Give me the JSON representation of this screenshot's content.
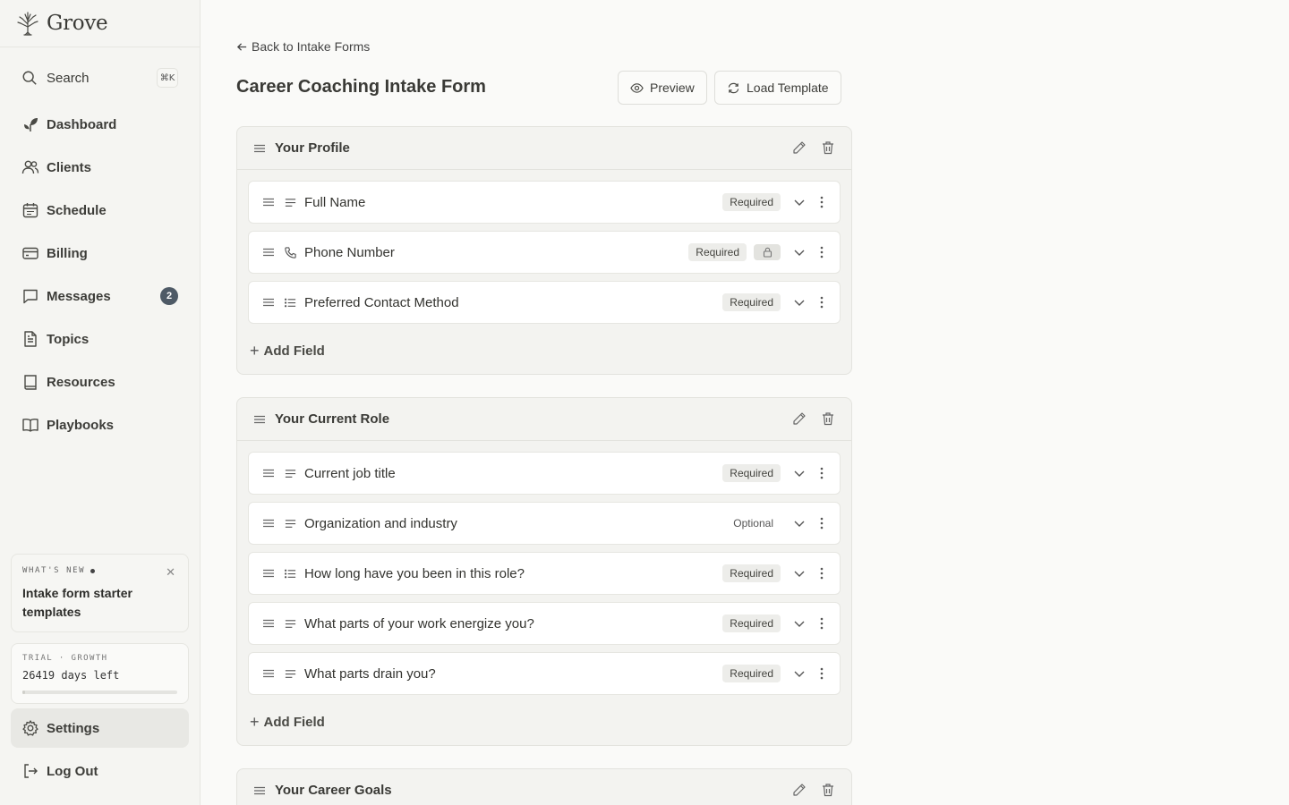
{
  "brand": {
    "name": "Grove"
  },
  "sidebar": {
    "search": {
      "label": "Search",
      "shortcut": "⌘K"
    },
    "items": [
      {
        "key": "dashboard",
        "label": "Dashboard",
        "icon": "sprout-icon"
      },
      {
        "key": "clients",
        "label": "Clients",
        "icon": "users-icon"
      },
      {
        "key": "schedule",
        "label": "Schedule",
        "icon": "calendar-icon"
      },
      {
        "key": "billing",
        "label": "Billing",
        "icon": "credit-card-icon"
      },
      {
        "key": "messages",
        "label": "Messages",
        "icon": "message-icon",
        "badge": "2"
      },
      {
        "key": "topics",
        "label": "Topics",
        "icon": "document-icon"
      },
      {
        "key": "resources",
        "label": "Resources",
        "icon": "book-icon"
      },
      {
        "key": "playbooks",
        "label": "Playbooks",
        "icon": "open-book-icon"
      }
    ],
    "whats_new": {
      "kicker": "WHAT'S NEW",
      "title": "Intake form starter templates"
    },
    "trial": {
      "kicker": "TRIAL · GROWTH",
      "days": "26419 days left",
      "progress": 0.02
    },
    "settings_label": "Settings",
    "logout_label": "Log Out"
  },
  "page": {
    "back_label": "Back to Intake Forms",
    "title": "Career Coaching Intake Form",
    "preview_label": "Preview",
    "load_template_label": "Load Template",
    "add_field_label": "Add Field"
  },
  "sections": [
    {
      "title": "Your Profile",
      "fields": [
        {
          "label": "Full Name",
          "type": "text",
          "status": "Required"
        },
        {
          "label": "Phone Number",
          "type": "phone",
          "status": "Required",
          "locked": true
        },
        {
          "label": "Preferred Contact Method",
          "type": "list",
          "status": "Required"
        }
      ]
    },
    {
      "title": "Your Current Role",
      "fields": [
        {
          "label": "Current job title",
          "type": "text",
          "status": "Required"
        },
        {
          "label": "Organization and industry",
          "type": "text",
          "status": "Optional"
        },
        {
          "label": "How long have you been in this role?",
          "type": "list",
          "status": "Required"
        },
        {
          "label": "What parts of your work energize you?",
          "type": "text",
          "status": "Required"
        },
        {
          "label": "What parts drain you?",
          "type": "text",
          "status": "Required"
        }
      ]
    },
    {
      "title": "Your Career Goals",
      "fields": []
    }
  ],
  "colors": {
    "accent": "#4e5a66",
    "background": "#fafaf8",
    "sidebar": "#f5f5f2"
  }
}
